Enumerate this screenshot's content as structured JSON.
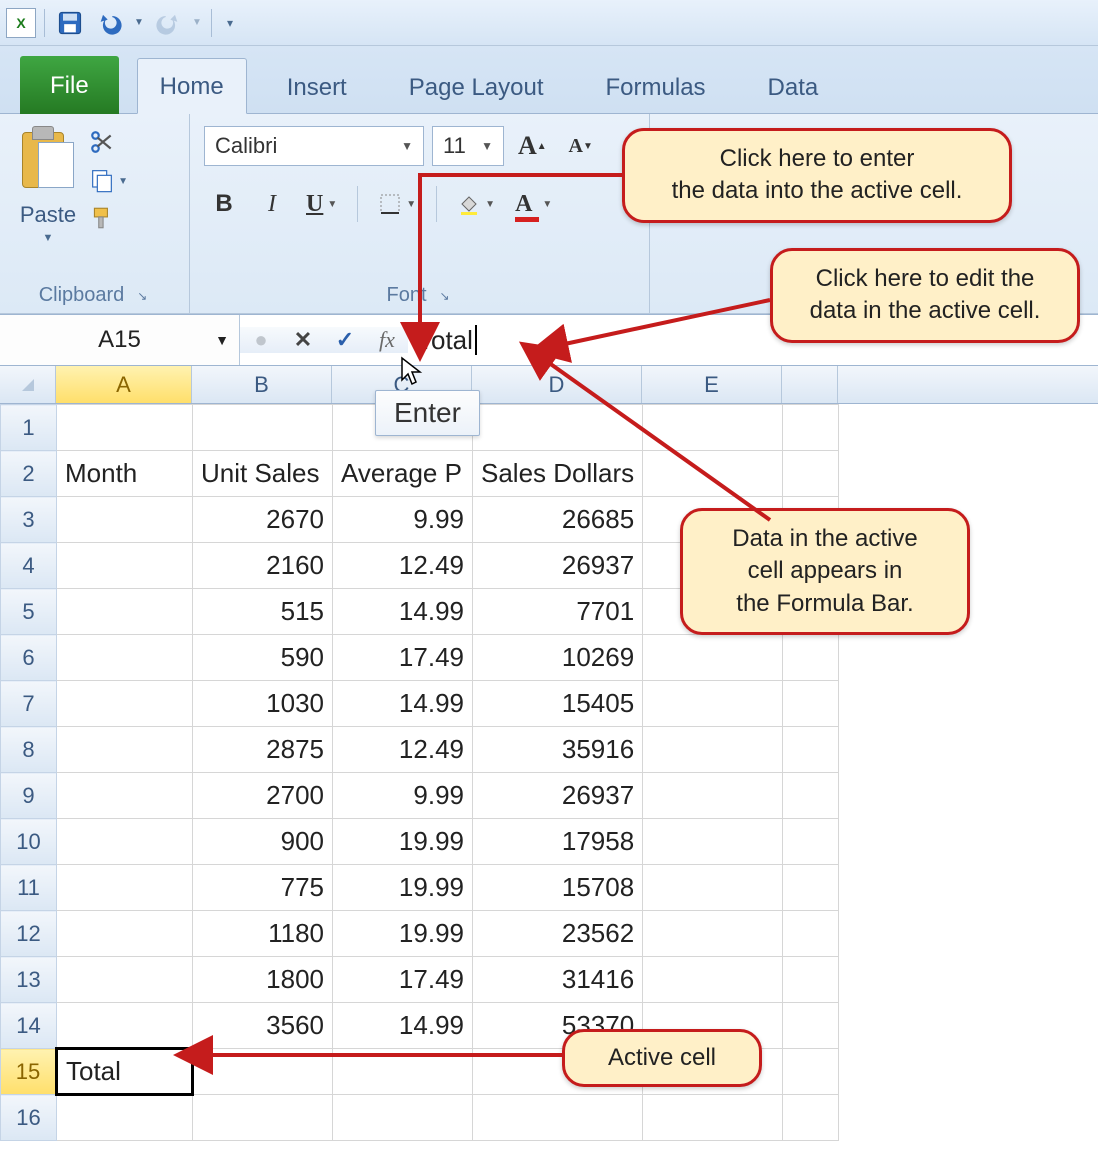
{
  "qat": {
    "app": "X",
    "save_title": "Save",
    "undo_title": "Undo",
    "redo_title": "Redo"
  },
  "tabs": {
    "file": "File",
    "home": "Home",
    "insert": "Insert",
    "page_layout": "Page Layout",
    "formulas": "Formulas",
    "data": "Data"
  },
  "ribbon": {
    "clipboard": {
      "paste": "Paste",
      "label": "Clipboard"
    },
    "font": {
      "name": "Calibri",
      "size": "11",
      "label": "Font",
      "bold": "B",
      "italic": "I",
      "underline": "U"
    }
  },
  "formula_bar": {
    "name_box": "A15",
    "cancel": "✕",
    "accept": "✓",
    "fx": "fx",
    "value": "Total"
  },
  "tooltip": "Enter",
  "columns": [
    "A",
    "B",
    "C",
    "D",
    "E"
  ],
  "headers": {
    "A": "Month",
    "B": "Unit Sales",
    "C": "Average P",
    "D": "Sales Dollars"
  },
  "rows": [
    {
      "n": 1
    },
    {
      "n": 2,
      "A": "Month",
      "B": "Unit Sales",
      "C": "Average P",
      "D": "Sales Dollars"
    },
    {
      "n": 3,
      "B": "2670",
      "C": "9.99",
      "D": "26685"
    },
    {
      "n": 4,
      "B": "2160",
      "C": "12.49",
      "D": "26937"
    },
    {
      "n": 5,
      "B": "515",
      "C": "14.99",
      "D": "7701"
    },
    {
      "n": 6,
      "B": "590",
      "C": "17.49",
      "D": "10269"
    },
    {
      "n": 7,
      "B": "1030",
      "C": "14.99",
      "D": "15405"
    },
    {
      "n": 8,
      "B": "2875",
      "C": "12.49",
      "D": "35916"
    },
    {
      "n": 9,
      "B": "2700",
      "C": "9.99",
      "D": "26937"
    },
    {
      "n": 10,
      "B": "900",
      "C": "19.99",
      "D": "17958"
    },
    {
      "n": 11,
      "B": "775",
      "C": "19.99",
      "D": "15708"
    },
    {
      "n": 12,
      "B": "1180",
      "C": "19.99",
      "D": "23562"
    },
    {
      "n": 13,
      "B": "1800",
      "C": "17.49",
      "D": "31416"
    },
    {
      "n": 14,
      "B": "3560",
      "C": "14.99",
      "D": "53370"
    },
    {
      "n": 15,
      "A": "Total",
      "active": true
    },
    {
      "n": 16
    }
  ],
  "callouts": {
    "c1": "Click here to enter\nthe data into the active cell.",
    "c2": "Click here to edit the\ndata in the active cell.",
    "c3": "Data in the active\ncell appears in\nthe Formula Bar.",
    "c4": "Active cell"
  }
}
